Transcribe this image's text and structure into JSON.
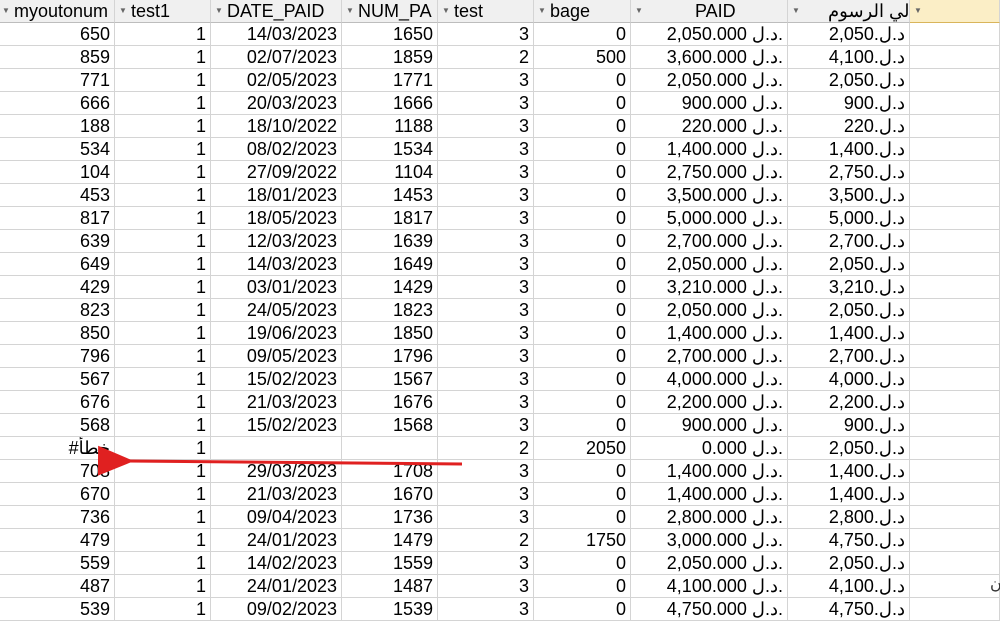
{
  "headers": [
    "myoutonum",
    "test1",
    "DATE_PAID",
    "NUM_PA",
    "test",
    "bage",
    "PAID",
    "إجمالي الرسوم",
    ""
  ],
  "rows": [
    [
      "650",
      "1",
      "14/03/2023",
      "1650",
      "3",
      "0",
      "2,050.000 د.ل.",
      "د.ل.2,050"
    ],
    [
      "859",
      "1",
      "02/07/2023",
      "1859",
      "2",
      "500",
      "3,600.000 د.ل.",
      "د.ل.4,100"
    ],
    [
      "771",
      "1",
      "02/05/2023",
      "1771",
      "3",
      "0",
      "2,050.000 د.ل.",
      "د.ل.2,050"
    ],
    [
      "666",
      "1",
      "20/03/2023",
      "1666",
      "3",
      "0",
      "900.000 د.ل.",
      "د.ل.900"
    ],
    [
      "188",
      "1",
      "18/10/2022",
      "1188",
      "3",
      "0",
      "220.000 د.ل.",
      "د.ل.220"
    ],
    [
      "534",
      "1",
      "08/02/2023",
      "1534",
      "3",
      "0",
      "1,400.000 د.ل.",
      "د.ل.1,400"
    ],
    [
      "104",
      "1",
      "27/09/2022",
      "1104",
      "3",
      "0",
      "2,750.000 د.ل.",
      "د.ل.2,750"
    ],
    [
      "453",
      "1",
      "18/01/2023",
      "1453",
      "3",
      "0",
      "3,500.000 د.ل.",
      "د.ل.3,500"
    ],
    [
      "817",
      "1",
      "18/05/2023",
      "1817",
      "3",
      "0",
      "5,000.000 د.ل.",
      "د.ل.5,000"
    ],
    [
      "639",
      "1",
      "12/03/2023",
      "1639",
      "3",
      "0",
      "2,700.000 د.ل.",
      "د.ل.2,700"
    ],
    [
      "649",
      "1",
      "14/03/2023",
      "1649",
      "3",
      "0",
      "2,050.000 د.ل.",
      "د.ل.2,050"
    ],
    [
      "429",
      "1",
      "03/01/2023",
      "1429",
      "3",
      "0",
      "3,210.000 د.ل.",
      "د.ل.3,210"
    ],
    [
      "823",
      "1",
      "24/05/2023",
      "1823",
      "3",
      "0",
      "2,050.000 د.ل.",
      "د.ل.2,050"
    ],
    [
      "850",
      "1",
      "19/06/2023",
      "1850",
      "3",
      "0",
      "1,400.000 د.ل.",
      "د.ل.1,400"
    ],
    [
      "796",
      "1",
      "09/05/2023",
      "1796",
      "3",
      "0",
      "2,700.000 د.ل.",
      "د.ل.2,700"
    ],
    [
      "567",
      "1",
      "15/02/2023",
      "1567",
      "3",
      "0",
      "4,000.000 د.ل.",
      "د.ل.4,000"
    ],
    [
      "676",
      "1",
      "21/03/2023",
      "1676",
      "3",
      "0",
      "2,200.000 د.ل.",
      "د.ل.2,200"
    ],
    [
      "568",
      "1",
      "15/02/2023",
      "1568",
      "3",
      "0",
      "900.000 د.ل.",
      "د.ل.900"
    ],
    [
      "#خطأ",
      "1",
      "",
      "",
      "2",
      "2050",
      "0.000 د.ل.",
      "د.ل.2,050"
    ],
    [
      "708",
      "1",
      "29/03/2023",
      "1708",
      "3",
      "0",
      "1,400.000 د.ل.",
      "د.ل.1,400"
    ],
    [
      "670",
      "1",
      "21/03/2023",
      "1670",
      "3",
      "0",
      "1,400.000 د.ل.",
      "د.ل.1,400"
    ],
    [
      "736",
      "1",
      "09/04/2023",
      "1736",
      "3",
      "0",
      "2,800.000 د.ل.",
      "د.ل.2,800"
    ],
    [
      "479",
      "1",
      "24/01/2023",
      "1479",
      "2",
      "1750",
      "3,000.000 د.ل.",
      "د.ل.4,750"
    ],
    [
      "559",
      "1",
      "14/02/2023",
      "1559",
      "3",
      "0",
      "2,050.000 د.ل.",
      "د.ل.2,050"
    ],
    [
      "487",
      "1",
      "24/01/2023",
      "1487",
      "3",
      "0",
      "4,100.000 د.ل.",
      "د.ل.4,100"
    ],
    [
      "539",
      "1",
      "09/02/2023",
      "1539",
      "3",
      "0",
      "4,750.000 د.ل.",
      "د.ل.4,750"
    ]
  ],
  "margin_text": "ن",
  "colors": {
    "header_bg": "#f0f0f0",
    "last_header_bg": "#fbeec6",
    "annotation_arrow": "#e02020",
    "grid_line": "#d4d4d4"
  }
}
